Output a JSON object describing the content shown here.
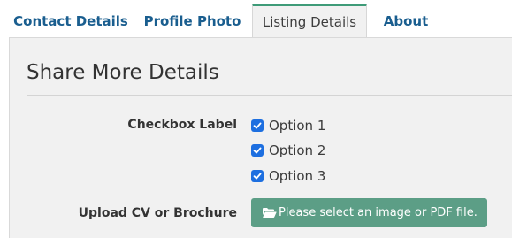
{
  "tabs": [
    {
      "label": "Contact Details",
      "active": false
    },
    {
      "label": "Profile Photo",
      "active": false
    },
    {
      "label": "Listing Details",
      "active": true
    },
    {
      "label": "About",
      "active": false
    }
  ],
  "panel": {
    "title": "Share More Details"
  },
  "checkbox_group": {
    "label": "Checkbox Label",
    "options": [
      {
        "label": "Option 1",
        "checked": true
      },
      {
        "label": "Option 2",
        "checked": true
      },
      {
        "label": "Option 3",
        "checked": true
      }
    ]
  },
  "upload": {
    "label": "Upload CV or Brochure",
    "button_text": "Please select an image or PDF file.",
    "icon": "folder-open-icon"
  },
  "colors": {
    "tab_link": "#1a5e8f",
    "active_tab_border": "#3e9b78",
    "panel_bg": "#f1f1f1",
    "checkbox": "#1d6fe0",
    "upload_button": "#5c9e86"
  }
}
